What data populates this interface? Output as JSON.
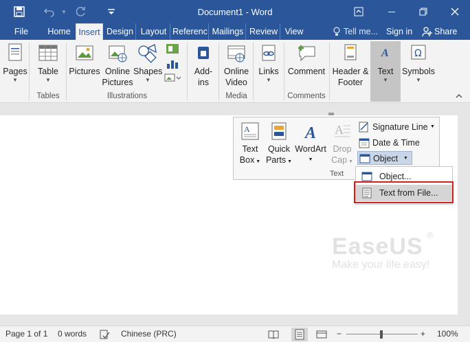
{
  "window": {
    "title": "Document1 - Word",
    "accent": "#2b579a",
    "icons": [
      "save-icon",
      "undo-icon",
      "redo-icon",
      "customize-icon",
      "ribbon-display-icon",
      "minimize-icon",
      "restore-icon",
      "close-icon"
    ]
  },
  "tabs": [
    "File",
    "Home",
    "Insert",
    "Design",
    "Layout",
    "Referenc",
    "Mailings",
    "Review",
    "View"
  ],
  "active_tab": "Insert",
  "tell_me": "Tell me...",
  "sign_in": "Sign in",
  "share": "Share",
  "ribbon": {
    "buttons": {
      "pages": "Pages",
      "table": "Table",
      "pictures": "Pictures",
      "online_pictures_1": "Online",
      "online_pictures_2": "Pictures",
      "shapes": "Shapes",
      "addins_1": "Add-",
      "addins_2": "ins",
      "online_video_1": "Online",
      "online_video_2": "Video",
      "links": "Links",
      "comment": "Comment",
      "header_footer_1": "Header &",
      "header_footer_2": "Footer",
      "text": "Text",
      "symbols": "Symbols"
    },
    "groups": {
      "tables": "Tables",
      "illustrations": "Illustrations",
      "media": "Media",
      "comments": "Comments"
    }
  },
  "text_panel": {
    "text_box_1": "Text",
    "text_box_2": "Box",
    "quick_parts_1": "Quick",
    "quick_parts_2": "Parts",
    "wordart": "WordArt",
    "drop_cap_1": "Drop",
    "drop_cap_2": "Cap",
    "signature_line": "Signature Line",
    "date_time": "Date & Time",
    "object": "Object",
    "group_label": "Text"
  },
  "object_menu": {
    "items": [
      "Object...",
      "Text from File..."
    ],
    "highlighted": "Text from File..."
  },
  "watermark": {
    "logo": "EaseUS",
    "reg": "®",
    "tagline": "Make your life easy!"
  },
  "status_bar": {
    "page": "Page 1 of 1",
    "words": "0 words",
    "language": "Chinese (PRC)",
    "zoom": "100%"
  }
}
